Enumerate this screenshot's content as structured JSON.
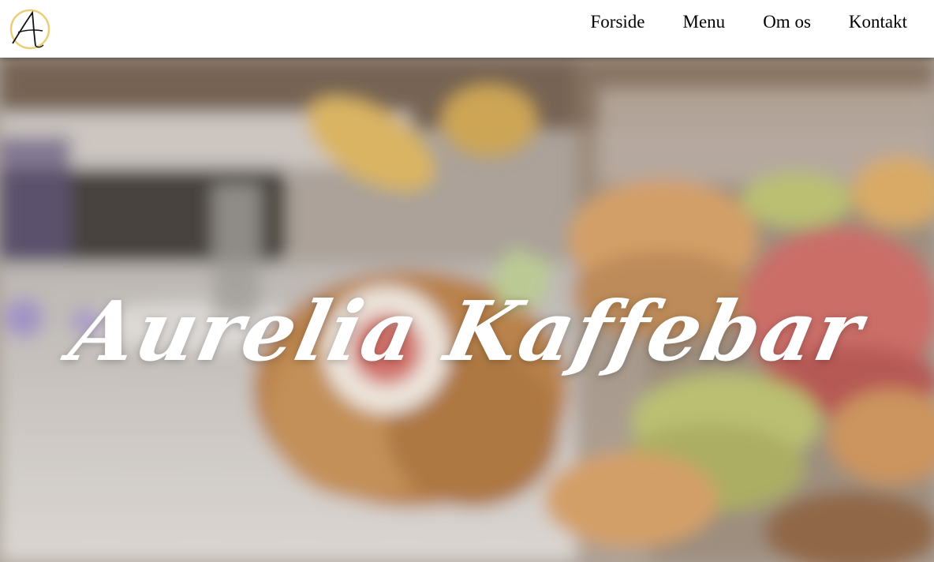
{
  "logo": {
    "letter": "A",
    "icon": "aurelia-monogram-logo",
    "ring_color": "#e7c560"
  },
  "nav": {
    "items": [
      {
        "label": "Forside"
      },
      {
        "label": "Menu"
      },
      {
        "label": "Om os"
      },
      {
        "label": "Kontakt"
      }
    ]
  },
  "hero": {
    "title": "Aurelia Kaffebar",
    "background": "blurred-cafe-macarons-cookies-jar-photo"
  },
  "colors": {
    "nav_bg": "#ffffff",
    "nav_text": "#000000",
    "hero_title": "#ffffff",
    "macaron_pink": "#c8655f",
    "macaron_green": "#b6bb6a",
    "macaron_tan": "#d19a5f",
    "gold_wing": "#d8b05a"
  }
}
